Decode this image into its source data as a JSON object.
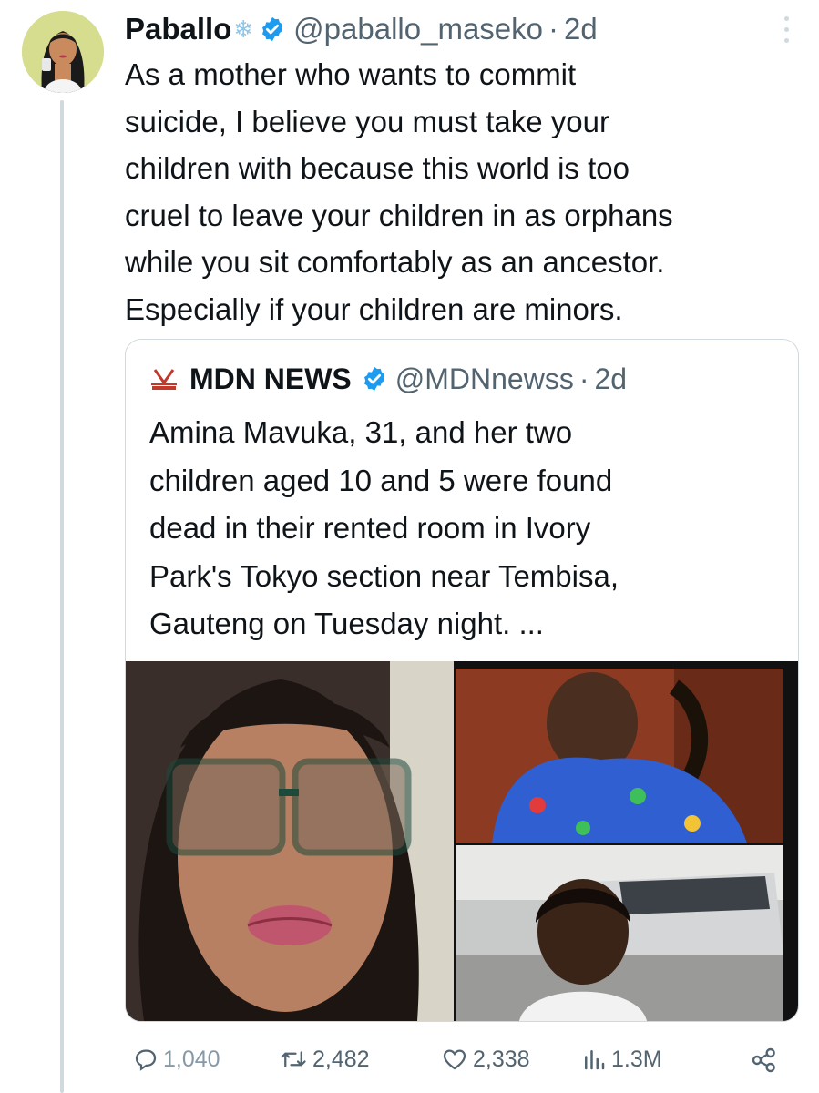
{
  "author": {
    "display_name": "Paballo",
    "emoji": "❄",
    "handle": "@paballo_maseko",
    "separator": "·",
    "time": "2d"
  },
  "tweet": {
    "lines": [
      "As a mother who wants to commit",
      "suicide, I believe you must take your",
      "children with because this world is too",
      "cruel to leave your children in as orphans",
      "while you sit comfortably as an ancestor.",
      "Especially if your children are minors."
    ]
  },
  "quote": {
    "display_name": "MDN NEWS",
    "handle": "@MDNnewss",
    "separator": "·",
    "time": "2d",
    "lines": [
      "Amina Mavuka, 31, and her two",
      "children aged 10 and 5 were found",
      "dead in their rented room in Ivory",
      "Park's Tokyo section near Tembisa,",
      "Gauteng on Tuesday night. ..."
    ]
  },
  "actions": {
    "replies": "1,040",
    "reposts": "2,482",
    "likes": "2,338",
    "views": "1.3M"
  },
  "colors": {
    "verified": "#1d9bf0",
    "muted": "#536471",
    "border": "#cfd9de"
  }
}
